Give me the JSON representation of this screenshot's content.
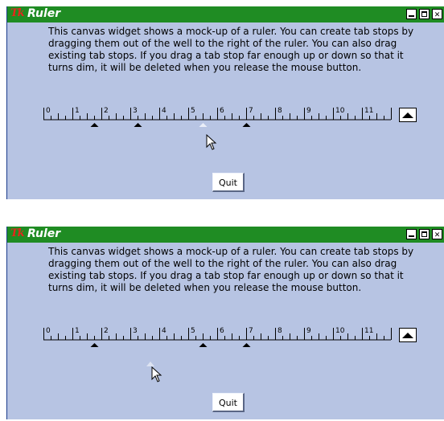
{
  "window_title": "Ruler",
  "message": "This canvas widget shows a mock-up of a ruler.  You can create tab stops by dragging them out of the well to the right of the ruler.  You can also drag existing tab stops.  If you drag a tab stop far enough up or down so that it turns dim, it will be deleted when you release the mouse button.",
  "quit_label": "Quit",
  "tk_logo": "Tk",
  "ruler_numbers": [
    "0",
    "1",
    "2",
    "3",
    "4",
    "5",
    "6",
    "7",
    "8",
    "9",
    "10",
    "11"
  ],
  "colors": {
    "title_bar": "#1f8c23",
    "background": "#b7c4e3",
    "tab_stop": "#000000",
    "dim_tab_stop": "#eaeef8"
  },
  "icons": {
    "minimize": "minimize-icon",
    "maximize": "maximize-icon",
    "close": "close-icon",
    "well": "up-triangle-icon",
    "cursor": "arrow-cursor-icon"
  },
  "screens": [
    {
      "tab_stops": [
        {
          "position": 1.75,
          "dim": false
        },
        {
          "position": 3.25,
          "dim": false
        },
        {
          "position": 5.5,
          "dim": true
        },
        {
          "position": 7.0,
          "dim": false
        }
      ]
    },
    {
      "tab_stops": [
        {
          "position": 1.75,
          "dim": false
        },
        {
          "position": 5.5,
          "dim": false
        },
        {
          "position": 7.0,
          "dim": false
        }
      ],
      "dragged_stop": {
        "dim": true
      }
    }
  ]
}
